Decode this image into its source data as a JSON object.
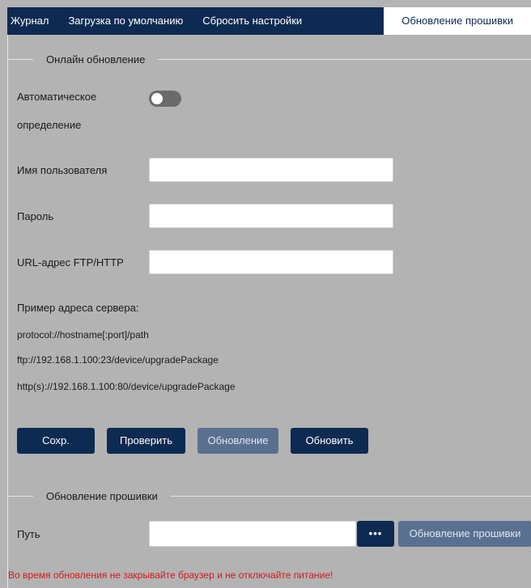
{
  "tabs": [
    {
      "label": "Журнал"
    },
    {
      "label": "Загрузка по умолчанию"
    },
    {
      "label": "Сбросить настройки"
    },
    {
      "label": "Обновление прошивки"
    }
  ],
  "online_section": {
    "title": "Онлайн обновление",
    "auto_detect_label_line1": "Автоматическое",
    "auto_detect_label_line2": "определение",
    "auto_detect_enabled": false,
    "username_label": "Имя пользователя",
    "username_value": "",
    "password_label": "Пароль",
    "password_value": "",
    "url_label": "URL-адрес FTP/HTTP",
    "url_value": "",
    "example_heading": "Пример адреса сервера:",
    "example_1": "protocol://hostname[:port]/path",
    "example_2": "ftp://192.168.1.100:23/device/upgradePackage",
    "example_3": "http(s)://192.168.1.100:80/device/upgradePackage",
    "buttons": {
      "save": "Сохр.",
      "check": "Проверить",
      "update": "Обновление",
      "upgrade": "Обновить"
    }
  },
  "firmware_section": {
    "title": "Обновление прошивки",
    "path_label": "Путь",
    "path_value": "",
    "browse_label": "•••",
    "upgrade_button": "Обновление прошивки",
    "warning": "Во время обновления не закрывайте браузер и не отключайте питание!"
  },
  "colors": {
    "navy": "#0d2a52",
    "background": "#b3b3b3",
    "warning": "#d4191b"
  }
}
